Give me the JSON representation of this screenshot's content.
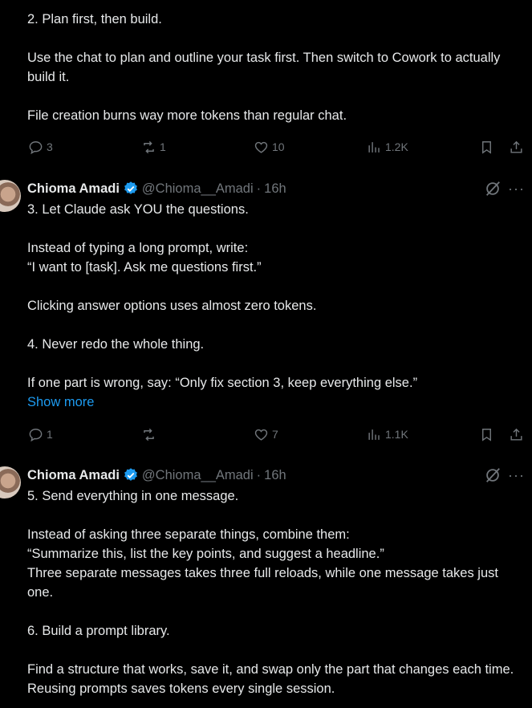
{
  "tweet1": {
    "paragraphs": [
      "2.  Plan first, then build.",
      "Use the chat to plan and outline your task first. Then switch to Cowork to actually build it.",
      "File creation burns way more tokens than regular chat."
    ],
    "replies": "3",
    "reposts": "1",
    "likes": "10",
    "views": "1.2K"
  },
  "tweet2": {
    "author_name": "Chioma Amadi",
    "handle": "@Chioma__Amadi",
    "separator": "·",
    "time": "16h",
    "paragraphs": [
      "3. Let Claude ask YOU the questions.",
      "Instead of typing a long prompt, write:",
      "“I want to [task]. Ask me questions first.”",
      "Clicking answer options uses almost zero tokens.",
      "4. Never redo the whole thing.",
      "If one part is wrong, say: “Only fix section 3, keep everything else.”"
    ],
    "show_more": "Show more",
    "replies": "1",
    "reposts": "",
    "likes": "7",
    "views": "1.1K"
  },
  "tweet3": {
    "author_name": "Chioma Amadi",
    "handle": "@Chioma__Amadi",
    "separator": "·",
    "time": "16h",
    "paragraphs": [
      "5. Send everything in one message.",
      "Instead of asking three separate things, combine them:",
      "“Summarize this, list the key points, and suggest a headline.”",
      "Three separate messages takes three full reloads, while one message takes just one.",
      "6. Build a prompt library.",
      "Find a structure that works, save it, and swap only the part that changes each time. Reusing prompts saves tokens every single session."
    ]
  },
  "icons": {
    "reply": "reply-icon",
    "repost": "repost-icon",
    "like": "heart-icon",
    "views": "views-icon",
    "bookmark": "bookmark-icon",
    "share": "share-icon",
    "grok": "grok-icon",
    "more": "more-icon",
    "verified": "verified-badge-icon"
  },
  "colors": {
    "background": "#000000",
    "text": "#e7e9ea",
    "muted": "#71767b",
    "accent": "#1d9bf0"
  }
}
